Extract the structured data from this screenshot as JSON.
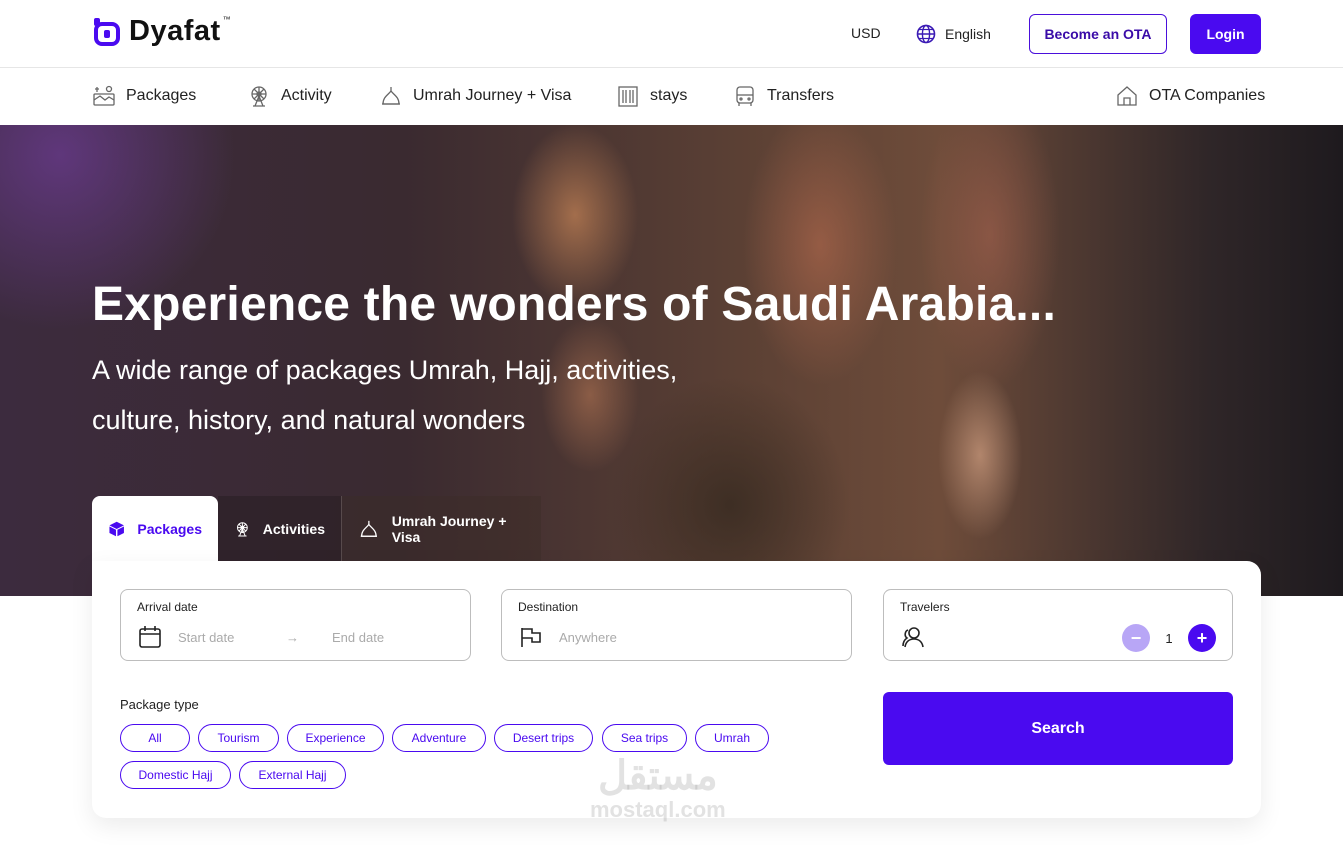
{
  "brand": {
    "name": "Dyafat",
    "tm": "™",
    "color": "#4a0af0"
  },
  "header": {
    "currency": "USD",
    "language": "English",
    "become_ota": "Become an OTA",
    "login": "Login"
  },
  "nav": {
    "items": [
      {
        "label": "Packages",
        "icon": "packages-icon"
      },
      {
        "label": "Activity",
        "icon": "ferris-wheel-icon"
      },
      {
        "label": "Umrah Journey + Visa",
        "icon": "mosque-dome-icon"
      },
      {
        "label": "stays",
        "icon": "building-icon"
      },
      {
        "label": "Transfers",
        "icon": "bus-icon"
      }
    ],
    "right": {
      "label": "OTA Companies",
      "icon": "house-icon"
    }
  },
  "hero": {
    "title": "Experience the wonders of Saudi Arabia...",
    "subtitle_line1": "A wide range of packages Umrah, Hajj, activities,",
    "subtitle_line2": "culture, history, and natural wonders"
  },
  "tabs": [
    {
      "label": "Packages",
      "icon": "box-icon",
      "active": true
    },
    {
      "label": "Activities",
      "icon": "ferris-wheel-icon",
      "active": false
    },
    {
      "label": "Umrah Journey + Visa",
      "icon": "mosque-dome-icon",
      "active": false
    }
  ],
  "search": {
    "arrival": {
      "label": "Arrival date",
      "start": "Start date",
      "arrow": "→",
      "end": "End date"
    },
    "destination": {
      "label": "Destination",
      "placeholder": "Anywhere"
    },
    "travelers": {
      "label": "Travelers",
      "value": "1",
      "minus": "−",
      "plus": "+"
    },
    "package_type_label": "Package type",
    "package_types": [
      "All",
      "Tourism",
      "Experience",
      "Adventure",
      "Desert trips",
      "Sea trips",
      "Umrah",
      "Domestic Hajj",
      "External Hajj"
    ],
    "button": "Search"
  },
  "watermark": {
    "arabic": "مستقل",
    "latin": "mostaql.com"
  }
}
